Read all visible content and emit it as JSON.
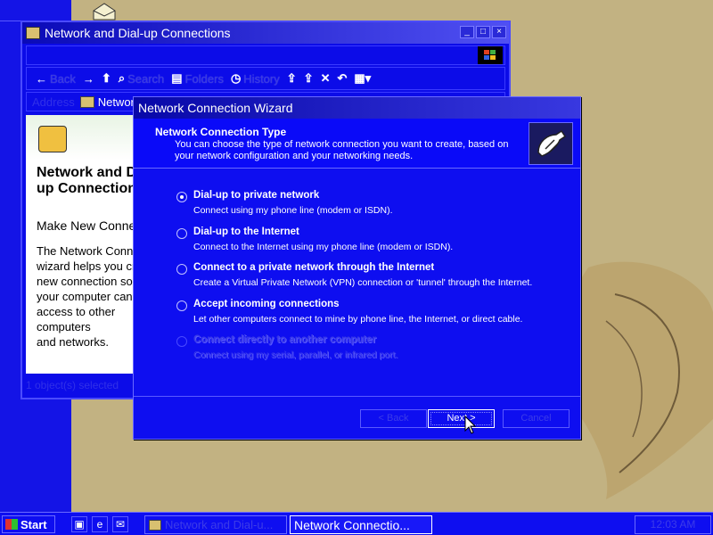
{
  "explorer": {
    "title": "Network and Dial-up Connections",
    "toolbar": {
      "back": "Back",
      "search": "Search",
      "folders": "Folders",
      "history": "History"
    },
    "address_label": "Address",
    "address_value": "Network and Dial-up Connections",
    "panel_title": "Network and Dial-up Connections",
    "panel_make": "Make New Connection",
    "panel_desc": "The Network Connection\nwizard helps you create\nnew connection so that\nyour computer can gain\naccess to other computers\nand networks.",
    "status": "1 object(s) selected"
  },
  "wizard": {
    "title": "Network Connection Wizard",
    "header_title": "Network Connection Type",
    "header_sub": "You can choose the type of network connection you want to create, based on your network configuration and your networking needs.",
    "options": [
      {
        "title": "Dial-up to private network",
        "desc": "Connect using my phone line (modem or ISDN).",
        "checked": true,
        "enabled": true
      },
      {
        "title": "Dial-up to the Internet",
        "desc": "Connect to the Internet using my phone line (modem or ISDN).",
        "checked": false,
        "enabled": true
      },
      {
        "title": "Connect to a private network through the Internet",
        "desc": "Create a Virtual Private Network (VPN) connection or 'tunnel' through the Internet.",
        "checked": false,
        "enabled": true
      },
      {
        "title": "Accept incoming connections",
        "desc": "Let other computers connect to mine by phone line, the Internet, or direct cable.",
        "checked": false,
        "enabled": true
      },
      {
        "title": "Connect directly to another computer",
        "desc": "Connect using my serial, parallel, or infrared port.",
        "checked": false,
        "enabled": false
      }
    ],
    "back_label": "< Back",
    "next_label": "Next >",
    "cancel_label": "Cancel"
  },
  "taskbar": {
    "start_label": "Start",
    "tasks": [
      "Network and Dial-u...",
      "Network Connectio..."
    ],
    "clock": "12:03 AM"
  },
  "icons": {
    "window": "folder-network-icon",
    "wizard_header": "phone-plug-icon"
  }
}
